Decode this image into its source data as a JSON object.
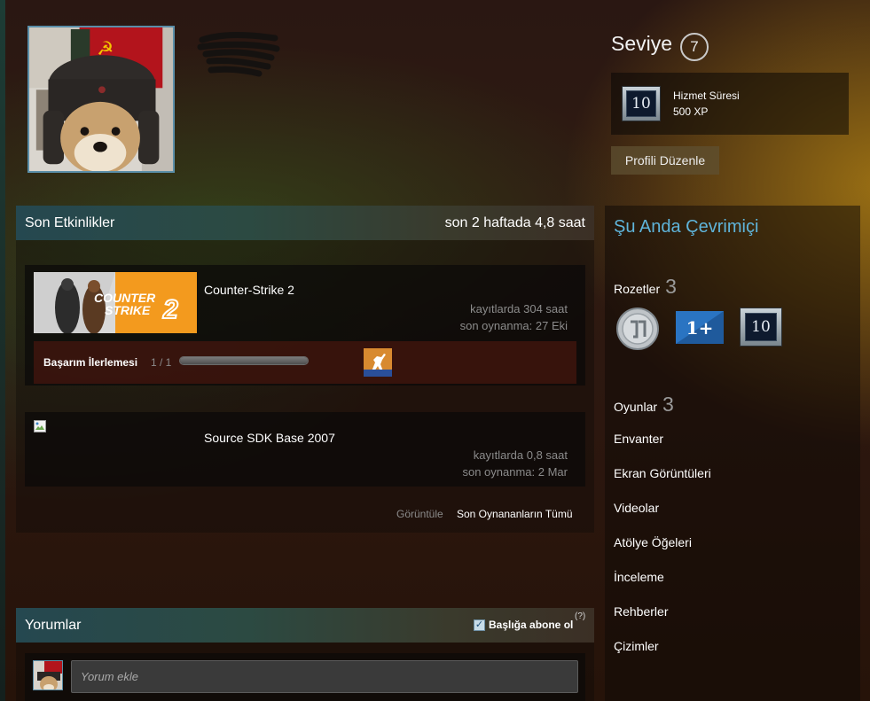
{
  "profile": {
    "level_title": "Seviye",
    "level_value": "7",
    "service": {
      "name": "Hizmet Süresi",
      "xp": "500 XP",
      "badge_value": "10"
    },
    "edit_label": "Profili Düzenle"
  },
  "activity": {
    "title": "Son Etkinlikler",
    "summary": "son 2 haftada 4,8 saat",
    "games": [
      {
        "name": "Counter-Strike 2",
        "banner_text": [
          "COUNTER",
          "STRIKE",
          "2"
        ],
        "hours_on_record": "kayıtlarda 304 saat",
        "last_played": "son oynanma: 27 Eki",
        "achievement_label": "Başarım İlerlemesi",
        "achievement_count": "1 / 1",
        "achievement_progress": 1.0
      },
      {
        "name": "Source SDK Base 2007",
        "hours_on_record": "kayıtlarda 0,8 saat",
        "last_played": "son oynanma: 2 Mar"
      }
    ],
    "view_label": "Görüntüle",
    "view_all": "Son Oynananların Tümü"
  },
  "comments": {
    "title": "Yorumlar",
    "subscribe_label": "Başlığa abone ol",
    "subscribe_checked": true,
    "help": "(?)",
    "placeholder": "Yorum ekle"
  },
  "sidebar": {
    "status": "Şu Anda Çevrimiçi",
    "badges": {
      "label": "Rozetler",
      "count": "3",
      "items": [
        "coin-badge-icon",
        "one-plus-badge-icon",
        "ten-years-badge-icon"
      ],
      "ten_value": "10"
    },
    "games": {
      "label": "Oyunlar",
      "count": "3"
    },
    "links": [
      "Envanter",
      "Ekran Görüntüleri",
      "Videolar",
      "Atölye Öğeleri",
      "İnceleme",
      "Rehberler",
      "Çizimler"
    ]
  },
  "colors": {
    "online": "#5fb4da",
    "avatar_border": "#5a8ea8",
    "achievement_bg": "#46160e",
    "cs2_orange": "#f7941d"
  }
}
